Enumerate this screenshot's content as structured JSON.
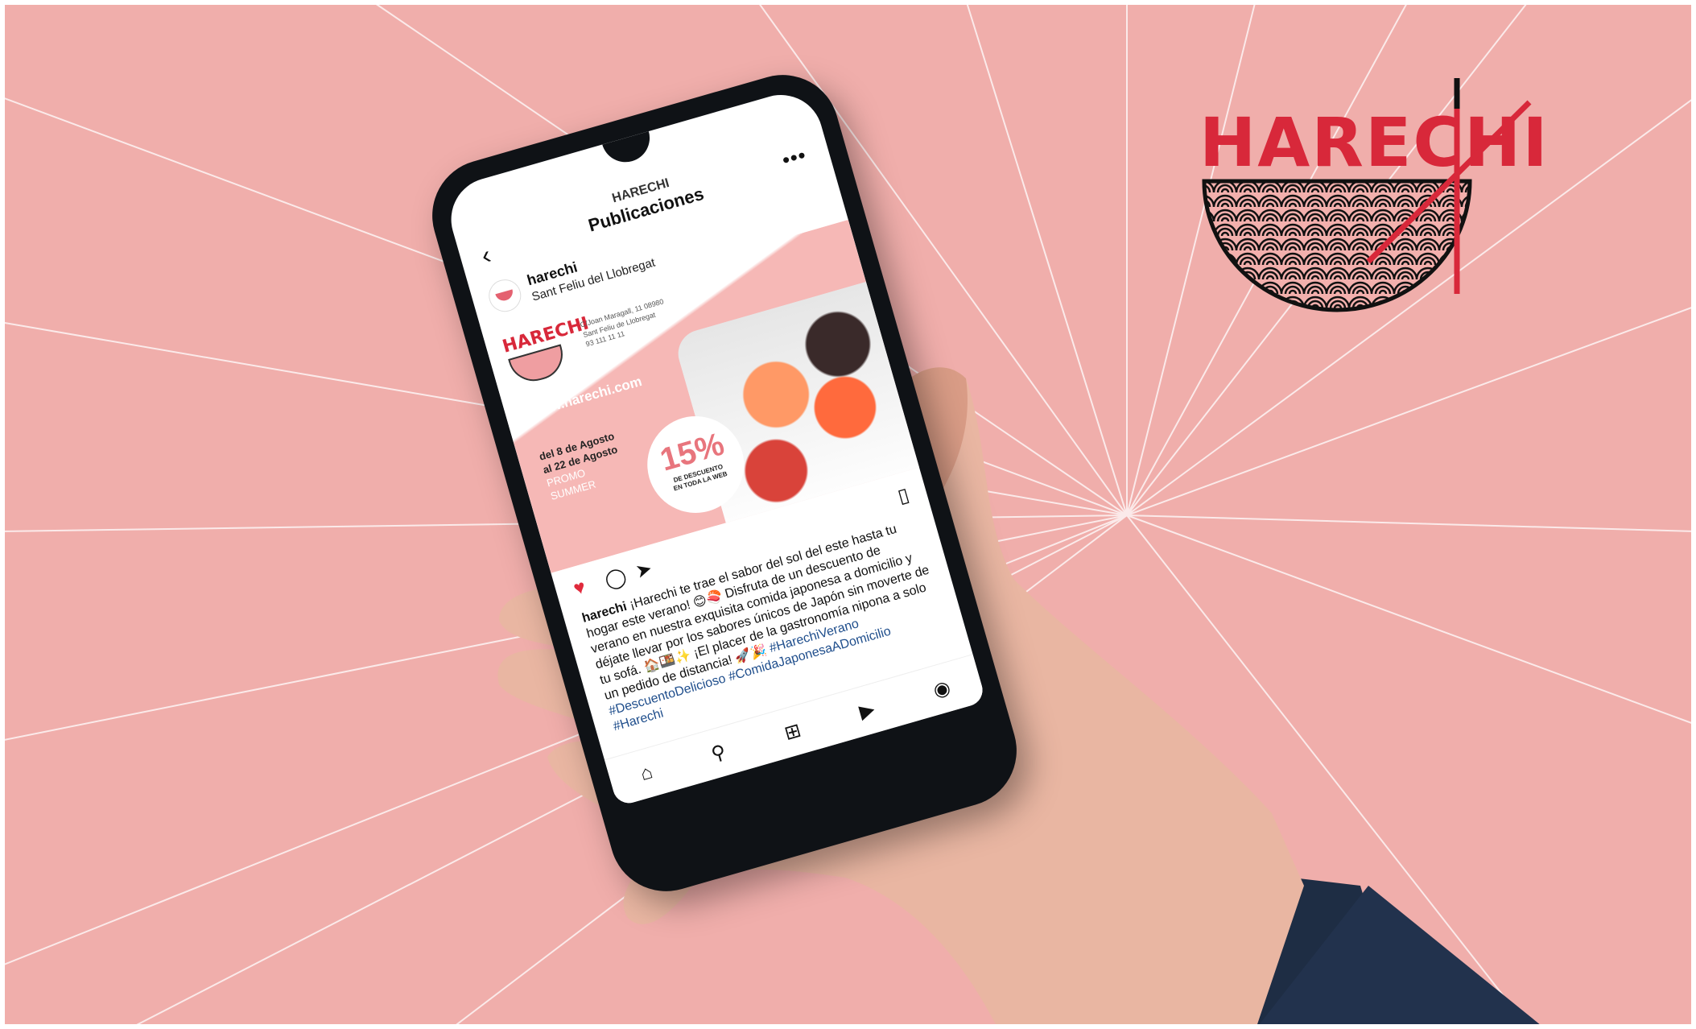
{
  "brand": {
    "logo_text": "HARECHI",
    "colors": {
      "background": "#f0aeab",
      "accent": "#d8283a",
      "ray": "#ffffff"
    }
  },
  "ig": {
    "header": {
      "account": "HARECHI",
      "title": "Publicaciones"
    },
    "post": {
      "username": "harechi",
      "location": "Sant Feliu del Llobregat",
      "image": {
        "logo_text": "HARECHI",
        "address_line1": "C/Joan Maragall, 11 08980",
        "address_line2": "Sant Feliu de Llobregat",
        "phone": "93 111 11 11",
        "website": "www.harechi.com",
        "date_from": "del 8 de Agosto",
        "date_to": "al 22 de Agosto",
        "promo_1": "PROMO",
        "promo_2": "SUMMER",
        "discount": "15%",
        "discount_line1": "DE DESCUENTO",
        "discount_line2": "EN TODA LA WEB"
      },
      "caption": {
        "user": "harechi",
        "text": "¡Harechi te trae el sabor del sol del este hasta tu hogar este verano! 😊🍣 Disfruta de un descuento de verano en nuestra exquisita comida japonesa a domicilio y déjate llevar por los sabores únicos de Japón sin moverte de tu sofá. 🏠🍱✨ ¡El placer de la gastronomía nipona a solo un pedido de distancia! 🚀🎉",
        "hashtags": [
          "#HarechiVerano",
          "#DescuentoDelicioso",
          "#ComidaJaponesaADomicilio",
          "#Harechi"
        ]
      }
    },
    "icons": {
      "back": "back-arrow-icon",
      "more": "more-icon",
      "like": "heart-icon",
      "comment": "comment-icon",
      "share": "send-icon",
      "save": "bookmark-icon",
      "home": "home-icon",
      "search": "search-icon",
      "create": "add-icon",
      "reels": "reels-icon",
      "profile": "profile-icon"
    }
  }
}
